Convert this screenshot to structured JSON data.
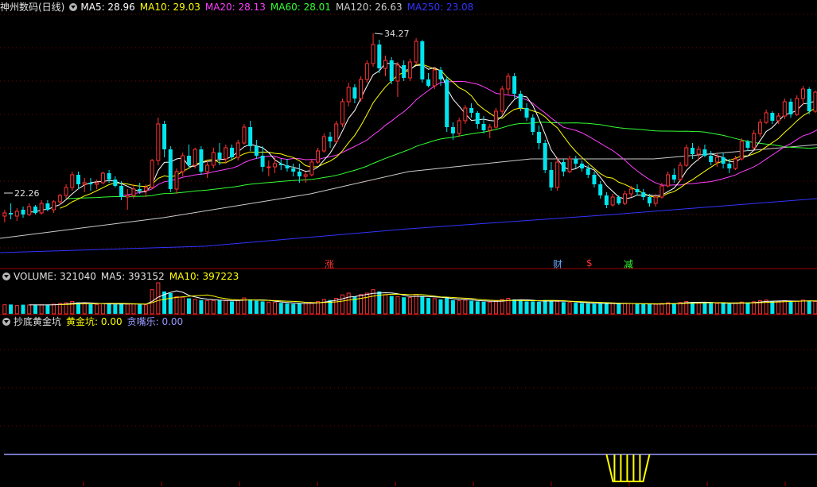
{
  "price_header": {
    "title": "神州数码(日线)",
    "ma": [
      {
        "label": "MA5: 28.96",
        "color": "#ffffff"
      },
      {
        "label": "MA10: 29.03",
        "color": "#ffff00"
      },
      {
        "label": "MA20: 28.13",
        "color": "#ff40ff"
      },
      {
        "label": "MA60: 28.01",
        "color": "#33ff33"
      },
      {
        "label": "MA120: 26.63",
        "color": "#cccccc"
      },
      {
        "label": "MA250: 23.08",
        "color": "#3333ff"
      }
    ]
  },
  "annotations": {
    "high": "34.27",
    "low": "22.26"
  },
  "markers": [
    {
      "text": "涨",
      "color": "#ff3333"
    },
    {
      "text": "财",
      "color": "#66aaff"
    },
    {
      "text": "$",
      "color": "#ff3333"
    },
    {
      "text": "减",
      "color": "#33ff33"
    }
  ],
  "volume_header": {
    "label": "VOLUME: 321040",
    "ma5": "MA5: 393152",
    "ma10": "MA10: 397223"
  },
  "indicator_header": {
    "title": "抄底黄金坑",
    "val1": "黄金坑: 0.00",
    "val2": "贪嘴乐: 0.00"
  },
  "colors": {
    "up": "#ff3333",
    "down": "#00e5ee",
    "grid": "#7a0000"
  },
  "chart_data": {
    "type": "candlestick",
    "candles": [
      [
        22.8,
        23.2,
        22.4,
        23.0,
        262000
      ],
      [
        23.0,
        23.6,
        22.6,
        22.9,
        270000
      ],
      [
        22.8,
        23.3,
        22.5,
        23.1,
        240000
      ],
      [
        23.2,
        23.4,
        22.7,
        22.9,
        265000
      ],
      [
        22.9,
        23.6,
        22.8,
        23.4,
        255000
      ],
      [
        23.4,
        23.5,
        22.9,
        23.0,
        258000
      ],
      [
        23.0,
        23.8,
        22.9,
        23.6,
        262000
      ],
      [
        23.6,
        23.8,
        23.1,
        23.2,
        252000
      ],
      [
        23.2,
        23.8,
        23.0,
        23.7,
        280000
      ],
      [
        23.7,
        24.2,
        23.5,
        24.1,
        300000
      ],
      [
        24.1,
        24.8,
        23.9,
        24.6,
        320000
      ],
      [
        24.6,
        25.6,
        24.4,
        25.4,
        360000
      ],
      [
        25.4,
        25.6,
        24.5,
        24.8,
        330000
      ],
      [
        24.8,
        25.2,
        24.3,
        24.9,
        300000
      ],
      [
        24.9,
        25.2,
        24.4,
        24.8,
        280000
      ],
      [
        24.8,
        25.1,
        24.5,
        24.9,
        270000
      ],
      [
        24.9,
        25.6,
        24.8,
        25.5,
        300000
      ],
      [
        25.5,
        25.7,
        24.9,
        25.1,
        290000
      ],
      [
        25.1,
        25.3,
        24.6,
        24.7,
        270000
      ],
      [
        24.7,
        25.0,
        23.8,
        24.0,
        300000
      ],
      [
        24.0,
        24.5,
        23.2,
        24.1,
        280000
      ],
      [
        24.1,
        24.8,
        23.9,
        24.5,
        290000
      ],
      [
        24.5,
        24.9,
        24.2,
        24.4,
        270000
      ],
      [
        24.4,
        24.8,
        24.0,
        24.6,
        260000
      ],
      [
        24.6,
        26.4,
        24.5,
        26.3,
        700000
      ],
      [
        26.3,
        29.0,
        26.0,
        28.6,
        900000
      ],
      [
        28.6,
        28.8,
        26.5,
        27.0,
        650000
      ],
      [
        27.0,
        27.2,
        24.3,
        24.5,
        600000
      ],
      [
        24.5,
        25.8,
        24.2,
        25.6,
        500000
      ],
      [
        25.6,
        26.8,
        25.3,
        26.6,
        480000
      ],
      [
        26.6,
        27.3,
        25.8,
        26.0,
        450000
      ],
      [
        26.0,
        27.1,
        25.8,
        27.0,
        420000
      ],
      [
        27.0,
        27.2,
        25.4,
        25.6,
        400000
      ],
      [
        25.6,
        26.3,
        25.2,
        26.0,
        380000
      ],
      [
        26.0,
        27.1,
        25.8,
        26.8,
        390000
      ],
      [
        26.8,
        27.4,
        26.0,
        26.4,
        400000
      ],
      [
        26.4,
        27.3,
        26.1,
        27.1,
        380000
      ],
      [
        27.1,
        27.3,
        26.3,
        26.5,
        360000
      ],
      [
        26.5,
        27.6,
        26.3,
        27.4,
        400000
      ],
      [
        27.4,
        28.6,
        27.3,
        28.4,
        460000
      ],
      [
        28.4,
        28.8,
        26.9,
        27.2,
        420000
      ],
      [
        27.2,
        27.6,
        26.4,
        26.6,
        380000
      ],
      [
        26.6,
        27.2,
        25.6,
        25.9,
        360000
      ],
      [
        25.9,
        26.3,
        25.3,
        25.9,
        340000
      ],
      [
        25.9,
        26.5,
        25.5,
        26.1,
        330000
      ],
      [
        26.1,
        26.4,
        25.7,
        26.0,
        320000
      ],
      [
        26.0,
        26.4,
        25.6,
        25.8,
        300000
      ],
      [
        25.8,
        26.1,
        25.3,
        25.6,
        290000
      ],
      [
        25.6,
        26.1,
        24.9,
        25.3,
        300000
      ],
      [
        25.3,
        25.6,
        24.9,
        25.4,
        300000
      ],
      [
        25.4,
        26.4,
        25.3,
        26.2,
        330000
      ],
      [
        26.2,
        27.1,
        26.1,
        26.9,
        360000
      ],
      [
        26.9,
        28.0,
        26.8,
        27.8,
        420000
      ],
      [
        27.8,
        28.1,
        27.1,
        27.5,
        400000
      ],
      [
        27.5,
        28.8,
        27.4,
        28.6,
        450000
      ],
      [
        28.6,
        30.2,
        28.4,
        30.0,
        550000
      ],
      [
        30.0,
        31.2,
        29.7,
        30.9,
        600000
      ],
      [
        30.9,
        31.1,
        29.9,
        30.2,
        500000
      ],
      [
        30.2,
        31.6,
        30.0,
        31.4,
        560000
      ],
      [
        31.4,
        32.6,
        31.2,
        32.4,
        600000
      ],
      [
        32.4,
        34.3,
        32.2,
        33.6,
        700000
      ],
      [
        33.6,
        33.9,
        31.8,
        32.1,
        650000
      ],
      [
        32.1,
        32.9,
        31.6,
        32.6,
        550000
      ],
      [
        32.6,
        32.8,
        31.1,
        31.3,
        520000
      ],
      [
        31.3,
        32.5,
        30.3,
        32.3,
        500000
      ],
      [
        32.3,
        32.6,
        31.3,
        31.5,
        480000
      ],
      [
        31.5,
        32.7,
        31.3,
        32.5,
        470000
      ],
      [
        32.5,
        34.0,
        32.3,
        33.8,
        560000
      ],
      [
        33.8,
        33.9,
        31.2,
        31.4,
        520000
      ],
      [
        31.4,
        31.8,
        30.9,
        31.0,
        460000
      ],
      [
        31.0,
        32.2,
        30.8,
        32.0,
        440000
      ],
      [
        32.0,
        32.2,
        31.0,
        31.4,
        420000
      ],
      [
        31.4,
        31.6,
        28.1,
        28.4,
        480000
      ],
      [
        28.4,
        28.7,
        27.6,
        28.0,
        400000
      ],
      [
        28.0,
        29.0,
        27.8,
        28.8,
        380000
      ],
      [
        28.8,
        29.8,
        28.6,
        29.6,
        400000
      ],
      [
        29.6,
        29.9,
        29.0,
        29.3,
        380000
      ],
      [
        29.3,
        29.4,
        28.3,
        28.6,
        360000
      ],
      [
        28.6,
        29.1,
        28.0,
        28.2,
        350000
      ],
      [
        28.2,
        28.6,
        27.7,
        28.4,
        340000
      ],
      [
        28.4,
        29.6,
        28.3,
        29.4,
        370000
      ],
      [
        29.4,
        31.0,
        29.2,
        30.8,
        420000
      ],
      [
        30.8,
        31.8,
        30.4,
        31.6,
        450000
      ],
      [
        31.6,
        31.8,
        30.2,
        30.5,
        420000
      ],
      [
        30.5,
        30.7,
        29.4,
        29.6,
        380000
      ],
      [
        29.6,
        29.9,
        28.8,
        29.0,
        360000
      ],
      [
        29.0,
        29.2,
        27.9,
        28.1,
        360000
      ],
      [
        28.1,
        28.5,
        27.0,
        27.4,
        350000
      ],
      [
        27.4,
        27.6,
        25.5,
        25.7,
        400000
      ],
      [
        25.7,
        26.2,
        24.4,
        24.6,
        380000
      ],
      [
        24.6,
        26.5,
        24.4,
        26.2,
        360000
      ],
      [
        26.2,
        26.4,
        25.3,
        25.6,
        340000
      ],
      [
        25.6,
        26.6,
        25.5,
        26.4,
        330000
      ],
      [
        26.4,
        26.6,
        25.8,
        26.1,
        320000
      ],
      [
        26.1,
        26.3,
        25.6,
        25.8,
        310000
      ],
      [
        25.8,
        26.0,
        25.2,
        25.4,
        300000
      ],
      [
        25.4,
        25.6,
        24.6,
        24.8,
        290000
      ],
      [
        24.8,
        25.0,
        23.9,
        24.1,
        300000
      ],
      [
        24.1,
        24.3,
        23.3,
        23.5,
        310000
      ],
      [
        23.5,
        24.2,
        23.4,
        24.0,
        300000
      ],
      [
        24.0,
        24.1,
        23.5,
        23.6,
        290000
      ],
      [
        23.6,
        24.4,
        23.5,
        24.2,
        295000
      ],
      [
        24.2,
        24.7,
        24.0,
        24.5,
        300000
      ],
      [
        24.5,
        24.8,
        24.1,
        24.3,
        285000
      ],
      [
        24.3,
        24.5,
        23.8,
        24.0,
        280000
      ],
      [
        24.0,
        24.2,
        23.4,
        23.6,
        275000
      ],
      [
        23.6,
        24.2,
        23.4,
        24.0,
        280000
      ],
      [
        24.0,
        24.9,
        23.9,
        24.7,
        300000
      ],
      [
        24.7,
        25.6,
        24.6,
        25.4,
        320000
      ],
      [
        25.4,
        25.8,
        24.9,
        25.1,
        310000
      ],
      [
        25.1,
        26.2,
        25.0,
        26.0,
        330000
      ],
      [
        26.0,
        27.3,
        25.9,
        27.1,
        360000
      ],
      [
        27.1,
        27.4,
        26.4,
        26.7,
        340000
      ],
      [
        26.7,
        27.2,
        26.3,
        27.0,
        330000
      ],
      [
        27.0,
        27.3,
        26.5,
        26.6,
        320000
      ],
      [
        26.6,
        26.9,
        26.0,
        26.2,
        310000
      ],
      [
        26.2,
        26.7,
        25.9,
        26.5,
        300000
      ],
      [
        26.5,
        26.8,
        25.8,
        26.1,
        300000
      ],
      [
        26.1,
        26.4,
        25.5,
        25.8,
        295000
      ],
      [
        25.8,
        26.6,
        25.7,
        26.4,
        310000
      ],
      [
        26.4,
        27.7,
        26.3,
        27.5,
        340000
      ],
      [
        27.5,
        27.6,
        26.9,
        27.1,
        330000
      ],
      [
        27.1,
        28.2,
        27.0,
        28.0,
        350000
      ],
      [
        28.0,
        28.9,
        27.8,
        28.7,
        380000
      ],
      [
        28.7,
        29.5,
        28.6,
        29.3,
        400000
      ],
      [
        29.3,
        29.4,
        28.6,
        28.8,
        370000
      ],
      [
        28.8,
        29.3,
        28.6,
        29.1,
        360000
      ],
      [
        29.1,
        30.2,
        28.9,
        30.0,
        380000
      ],
      [
        30.0,
        30.2,
        29.0,
        29.2,
        350000
      ],
      [
        29.2,
        30.4,
        29.1,
        30.2,
        370000
      ],
      [
        30.2,
        31.0,
        29.8,
        30.8,
        400000
      ],
      [
        30.8,
        30.9,
        29.2,
        29.4,
        380000
      ],
      [
        29.4,
        30.7,
        29.3,
        30.6,
        360000
      ],
      [
        30.6,
        31.2,
        30.4,
        31.0,
        340000
      ],
      [
        31.0,
        31.3,
        30.4,
        30.9,
        321040
      ]
    ],
    "price_range": [
      20.3,
      35.5
    ],
    "indicator_values": [
      {
        "name": "黄金坑",
        "range": [
          98,
          105
        ],
        "value": 1
      }
    ]
  }
}
